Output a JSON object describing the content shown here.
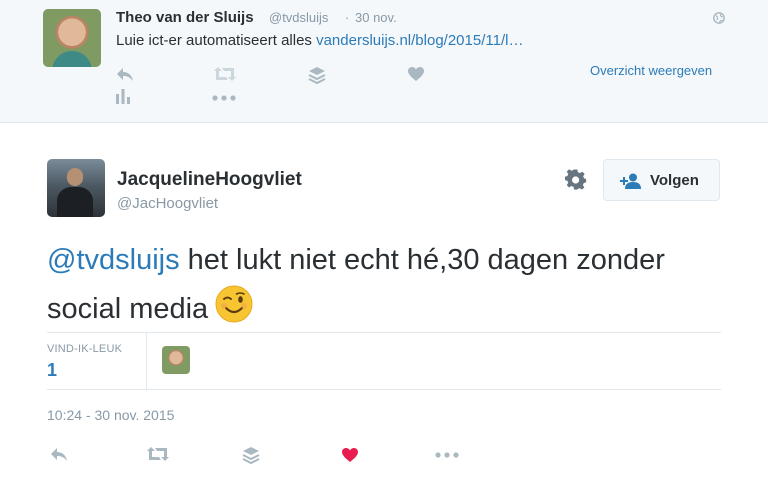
{
  "parent_tweet": {
    "author_name": "Theo van der Sluijs",
    "handle": "@tvdsluijs",
    "separator": "·",
    "date": "30 nov.",
    "text_prefix": "Luie ict-er automatiseert alles ",
    "link_text": "vandersluijs.nl/blog/2015/11/l…",
    "view_link": "Overzicht weergeven",
    "icons": [
      "reply-icon",
      "retweet-icon",
      "stack-icon",
      "heart-icon",
      "analytics-icon",
      "more-icon"
    ]
  },
  "main_tweet": {
    "author_name": "JacquelineHoogvliet",
    "handle": "@JacHoogvliet",
    "follow_label": "Volgen",
    "mention": "@tvdsluijs",
    "text_rest": " het lukt niet echt hé,30 dagen zonder social media",
    "emoji": "winking-face",
    "likes_label": "VIND-IK-LEUK",
    "likes_count": "1",
    "timestamp": "10:24 - 30 nov. 2015",
    "liked": true
  },
  "colors": {
    "link": "#2b7bb9",
    "muted": "#8899a6",
    "icon": "#aab8c2",
    "heart_active": "#e81c4f",
    "panel_bg": "#f5f8fa"
  }
}
